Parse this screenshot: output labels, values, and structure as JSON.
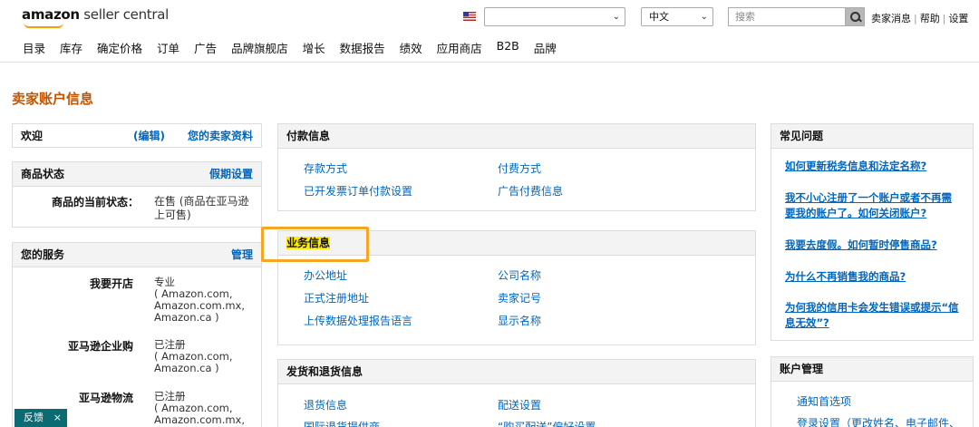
{
  "header": {
    "logo_brand": "amazon",
    "logo_product": " seller central",
    "language": "中文",
    "search_placeholder": "搜索",
    "links": [
      "卖家消息",
      "帮助",
      "设置"
    ]
  },
  "nav": [
    "目录",
    "库存",
    "确定价格",
    "订单",
    "广告",
    "品牌旗舰店",
    "增长",
    "数据报告",
    "绩效",
    "应用商店",
    "B2B",
    "品牌"
  ],
  "page_title": "卖家账户信息",
  "left": {
    "welcome": "欢迎",
    "edit": "(编辑)",
    "profile": "您的卖家资料",
    "listing_status": {
      "title": "商品状态",
      "action": "假期设置",
      "key": "商品的当前状态：",
      "value": "在售 (商品在亚马逊上可售)"
    },
    "services": {
      "title": "您的服务",
      "action": "管理",
      "rows": [
        {
          "key": "我要开店",
          "value_l1": "专业",
          "value_l2": "( Amazon.com,",
          "value_l3": "Amazon.com.mx,",
          "value_l4": "Amazon.ca )"
        },
        {
          "key": "亚马逊企业购",
          "value_l1": "已注册",
          "value_l2": "( Amazon.com,",
          "value_l3": "Amazon.ca )"
        },
        {
          "key": "亚马逊物流",
          "value_l1": "已注册",
          "value_l2": "( Amazon.com,",
          "value_l3": "Amazon.com.mx,"
        }
      ]
    }
  },
  "middle": {
    "payment": {
      "title": "付款信息",
      "links": [
        "存款方式",
        "付费方式",
        "已开发票订单付款设置",
        "广告付费信息"
      ]
    },
    "business": {
      "title": "业务信息",
      "links": [
        "办公地址",
        "公司名称",
        "正式注册地址",
        "卖家记号",
        "上传数据处理报告语言",
        "显示名称"
      ]
    },
    "shipping": {
      "title": "发货和退货信息",
      "links": [
        "退货信息",
        "配送设置",
        "国际退货提供商",
        "“购买配送”偏好设置"
      ]
    }
  },
  "right": {
    "faq": {
      "title": "常见问题",
      "items": [
        "如何更新税务信息和法定名称?",
        "我不小心注册了一个账户或者不再需要我的账户了。如何关闭账户?",
        "我要去度假。如何暂时停售商品?",
        "为什么不再销售我的商品?",
        "为何我的信用卡会发生错误或提示“信息无效”?"
      ]
    },
    "account": {
      "title": "账户管理",
      "items": [
        "通知首选项",
        "登录设置（更改姓名、电子邮件、"
      ]
    }
  },
  "feedback": {
    "label": "反馈",
    "close": "×"
  }
}
